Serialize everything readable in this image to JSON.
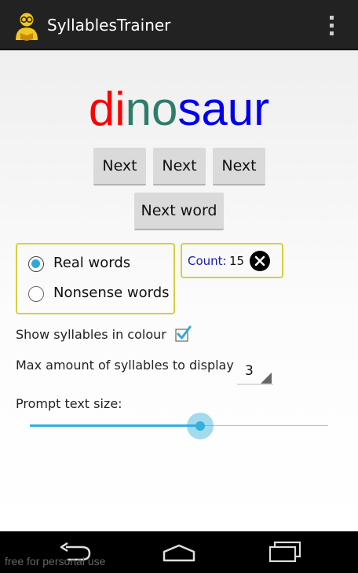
{
  "app": {
    "title": "SyllablesTrainer"
  },
  "prompt": {
    "syllables": [
      {
        "text": "di",
        "color": "#ff0000"
      },
      {
        "text": "no",
        "color": "#2e7d6b"
      },
      {
        "text": "saur",
        "color": "#0000ee"
      }
    ]
  },
  "buttons": {
    "next_1": "Next",
    "next_2": "Next",
    "next_3": "Next",
    "next_word": "Next word"
  },
  "word_type": {
    "options": [
      "Real words",
      "Nonsense words"
    ],
    "selected": "Real words"
  },
  "count": {
    "label": "Count:",
    "value": "15"
  },
  "settings": {
    "show_colour_label": "Show syllables in colour",
    "show_colour_checked": true,
    "max_syllables_label": "Max amount of syllables to display",
    "max_syllables_value": "3",
    "prompt_size_label": "Prompt text size:",
    "prompt_size_fraction": 0.57
  },
  "watermark": "free for personal use",
  "colors": {
    "accent": "#33b0dc",
    "box_border": "#d6cf3d",
    "action_bar": "#222222"
  }
}
